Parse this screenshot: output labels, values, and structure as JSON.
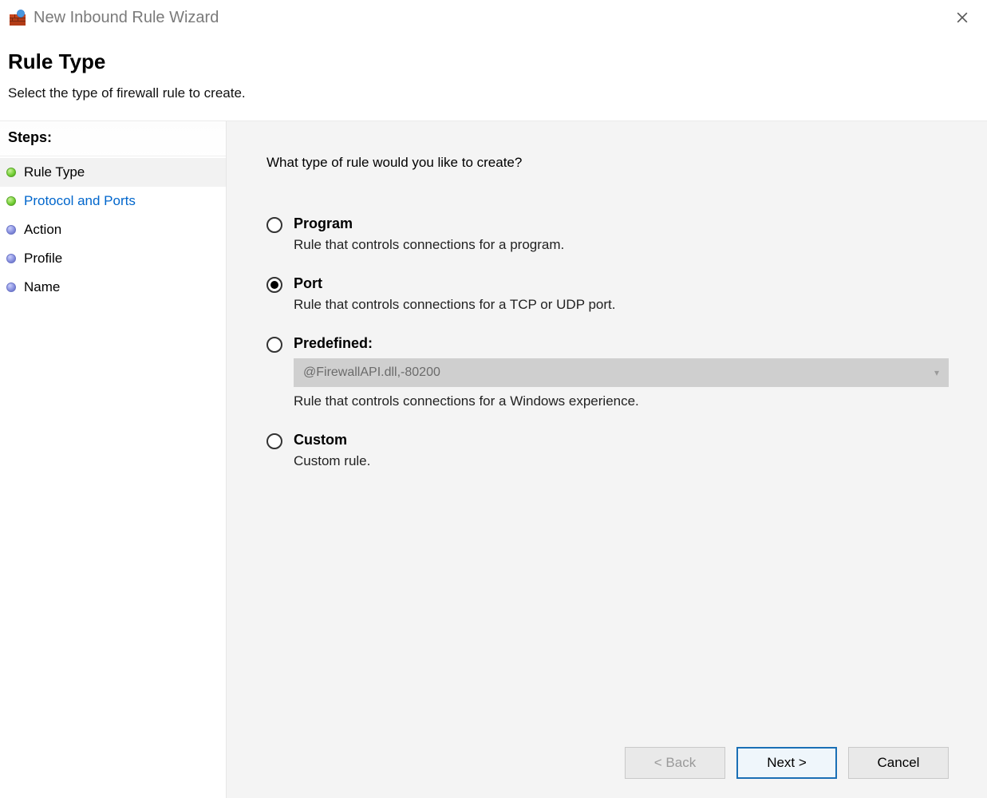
{
  "window": {
    "title": "New Inbound Rule Wizard"
  },
  "header": {
    "title": "Rule Type",
    "subtitle": "Select the type of firewall rule to create."
  },
  "sidebar": {
    "title": "Steps:",
    "items": [
      {
        "label": "Rule Type"
      },
      {
        "label": "Protocol and Ports"
      },
      {
        "label": "Action"
      },
      {
        "label": "Profile"
      },
      {
        "label": "Name"
      }
    ],
    "current_index": 0,
    "completed_through_index": 1
  },
  "main": {
    "question": "What type of rule would you like to create?",
    "selected_option": "port",
    "options": {
      "program": {
        "title": "Program",
        "desc": "Rule that controls connections for a program."
      },
      "port": {
        "title": "Port",
        "desc": "Rule that controls connections for a TCP or UDP port."
      },
      "predefined": {
        "title": "Predefined:",
        "select_value": "@FirewallAPI.dll,-80200",
        "desc": "Rule that controls connections for a Windows experience."
      },
      "custom": {
        "title": "Custom",
        "desc": "Custom rule."
      }
    }
  },
  "footer": {
    "back_label": "< Back",
    "next_label": "Next >",
    "cancel_label": "Cancel",
    "back_enabled": false
  }
}
